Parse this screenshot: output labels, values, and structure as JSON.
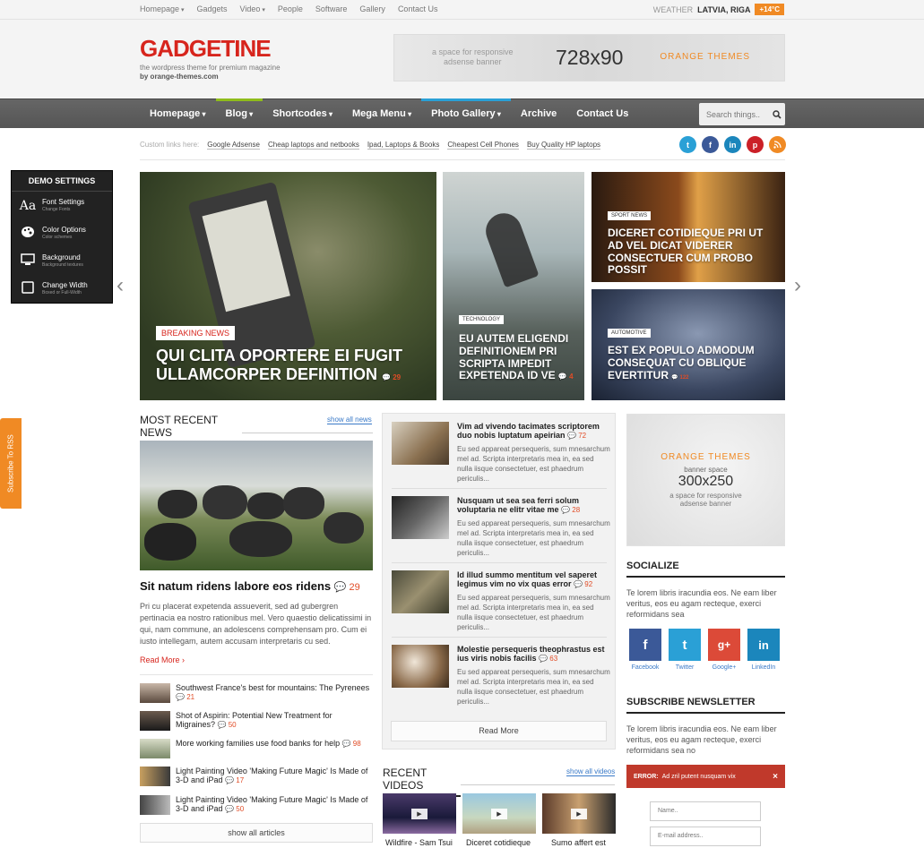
{
  "topbar": {
    "nav": [
      "Homepage",
      "Gadgets",
      "Video",
      "People",
      "Software",
      "Gallery",
      "Contact Us"
    ],
    "weather_label": "WEATHER",
    "weather_location": "LATVIA, RIGA",
    "weather_temp": "+14°C"
  },
  "header": {
    "logo": "GADGETINE",
    "tagline1": "the wordpress theme for premium magazine",
    "tagline2": "by orange-themes.com",
    "banner_small1": "a space for responsive",
    "banner_small2": "adsense banner",
    "banner_size": "728x90",
    "banner_brand": "ORANGE THEMES"
  },
  "nav": {
    "items": [
      "Homepage",
      "Blog",
      "Shortcodes",
      "Mega Menu",
      "Photo Gallery",
      "Archive",
      "Contact Us"
    ],
    "search_placeholder": "Search things.."
  },
  "custom_links": {
    "label": "Custom links here:",
    "links": [
      "Google Adsense",
      "Cheap laptops and netbooks",
      "Ipad, Laptops & Books",
      "Cheapest Cell Phones",
      "Buy Quality HP laptops"
    ]
  },
  "social_icons": [
    "twitter-icon",
    "facebook-icon",
    "linkedin-icon",
    "pinterest-icon",
    "rss-icon"
  ],
  "demo": {
    "title": "DEMO SETTINGS",
    "items": [
      {
        "label": "Font Settings",
        "sub": "Change Fonts",
        "icon": "Aa"
      },
      {
        "label": "Color Options",
        "sub": "Color schemes",
        "icon": "palette"
      },
      {
        "label": "Background",
        "sub": "Background textures",
        "icon": "monitor"
      },
      {
        "label": "Change Width",
        "sub": "Boxed or Full-Width",
        "icon": "tablet"
      }
    ]
  },
  "rss_tab": "Subscribe To RSS",
  "slider": {
    "main": {
      "tag": "BREAKING NEWS",
      "title1": "QUI CLITA OPORTERE EI FUGIT",
      "title2": "ULLAMCORPER DEFINITION",
      "comments": "29"
    },
    "mid": {
      "tag": "TECHNOLOGY",
      "title": "EU AUTEM ELIGENDI DEFINITIONEM PRI SCRIPTA IMPEDIT EXPETENDA ID VE",
      "comments": "4"
    },
    "right_top": {
      "tag": "SPORT NEWS",
      "title": "DICERET COTIDIEQUE PRI UT AD VEL DICAT VIDERER CONSECTUER CUM PROBO POSSIT"
    },
    "right_bottom": {
      "tag": "AUTOMOTIVE",
      "title": "EST EX POPULO ADMODUM CONSEQUAT CU OBLIQUE EVERTITUR",
      "comments": "122"
    }
  },
  "recent": {
    "title": "MOST RECENT NEWS",
    "show_all": "show all news",
    "feature_title": "Sit natum ridens labore eos ridens",
    "feature_comments": "29",
    "feature_text": "Pri cu placerat expetenda assueverit, sed ad gubergren pertinacia ea nostro rationibus mel. Vero quaestio delicatissimi in qui, nam commune, an adolescens comprehensam pro. Cum ei iusto intellegam, autem accusam interpretaris cu sed.",
    "read_more": "Read More",
    "stories": [
      {
        "title": "Southwest France's best for mountains: The Pyrenees",
        "comments": "21"
      },
      {
        "title": "Shot of Aspirin: Potential New Treatment for Migraines?",
        "comments": "50"
      },
      {
        "title": "More working families use food banks for help",
        "comments": "98"
      },
      {
        "title": "Light Painting Video 'Making Future Magic' Is Made of 3-D and iPad",
        "comments": "17"
      },
      {
        "title": "Light Painting Video 'Making Future Magic' Is Made of 3-D and iPad",
        "comments": "50"
      }
    ],
    "show_all_articles": "show all articles"
  },
  "middle": {
    "items": [
      {
        "title": "Vim ad vivendo tacimates scriptorem duo nobis luptatum apeirian",
        "comments": "72",
        "excerpt": "Eu sed appareat persequeris, sum mnesarchum mel ad. Scripta interpretaris mea in, ea sed nulla iisque consectetuer, est phaedrum periculis..."
      },
      {
        "title": "Nusquam ut sea sea ferri solum voluptaria ne elitr vitae me",
        "comments": "28",
        "excerpt": "Eu sed appareat persequeris, sum mnesarchum mel ad. Scripta interpretaris mea in, ea sed nulla iisque consectetuer, est phaedrum periculis..."
      },
      {
        "title": "Id illud summo mentitum vel saperet legimus vim no vix quas error",
        "comments": "92",
        "excerpt": "Eu sed appareat persequeris, sum mnesarchum mel ad. Scripta interpretaris mea in, ea sed nulla iisque consectetuer, est phaedrum periculis..."
      },
      {
        "title": "Molestie persequeris theophrastus est ius viris nobis facilis",
        "comments": "63",
        "excerpt": "Eu sed appareat persequeris, sum mnesarchum mel ad. Scripta interpretaris mea in, ea sed nulla iisque consectetuer, est phaedrum periculis..."
      }
    ],
    "read_more": "Read More"
  },
  "videos": {
    "title": "RECENT VIDEOS",
    "show_all": "show all videos",
    "items": [
      "Wildfire - Sam Tsui",
      "Diceret cotidieque",
      "Sumo affert est"
    ]
  },
  "sidebar": {
    "ad_brand": "ORANGE THEMES",
    "ad_small": "banner space",
    "ad_size": "300x250",
    "ad_line1": "a space for responsive",
    "ad_line2": "adsense banner",
    "socialize_title": "SOCIALIZE",
    "socialize_text": "Te lorem libris iracundia eos. Ne eam liber veritus, eos eu agam recteque, exerci reformidans sea",
    "social": [
      {
        "label": "Facebook",
        "glyph": "f",
        "color": "#3b5998"
      },
      {
        "label": "Twitter",
        "glyph": "t",
        "color": "#2aa0d6"
      },
      {
        "label": "Google+",
        "glyph": "g+",
        "color": "#dc4a38"
      },
      {
        "label": "LinkedIn",
        "glyph": "in",
        "color": "#1b86bc"
      }
    ],
    "newsletter_title": "SUBSCRIBE NEWSLETTER",
    "newsletter_text": "Te lorem libris iracundia eos. Ne eam liber veritus, eos eu agam recteque, exerci reformidans sea no",
    "error_label": "ERROR:",
    "error_text": "Ad zril putent nusquam vix",
    "error_close": "×",
    "name_placeholder": "Name..",
    "email_placeholder": "E-mail address.."
  },
  "colors": {
    "brand": "#d7251d",
    "accent": "#f08a24",
    "link": "#3a7ac8",
    "comment": "#e14c26"
  }
}
